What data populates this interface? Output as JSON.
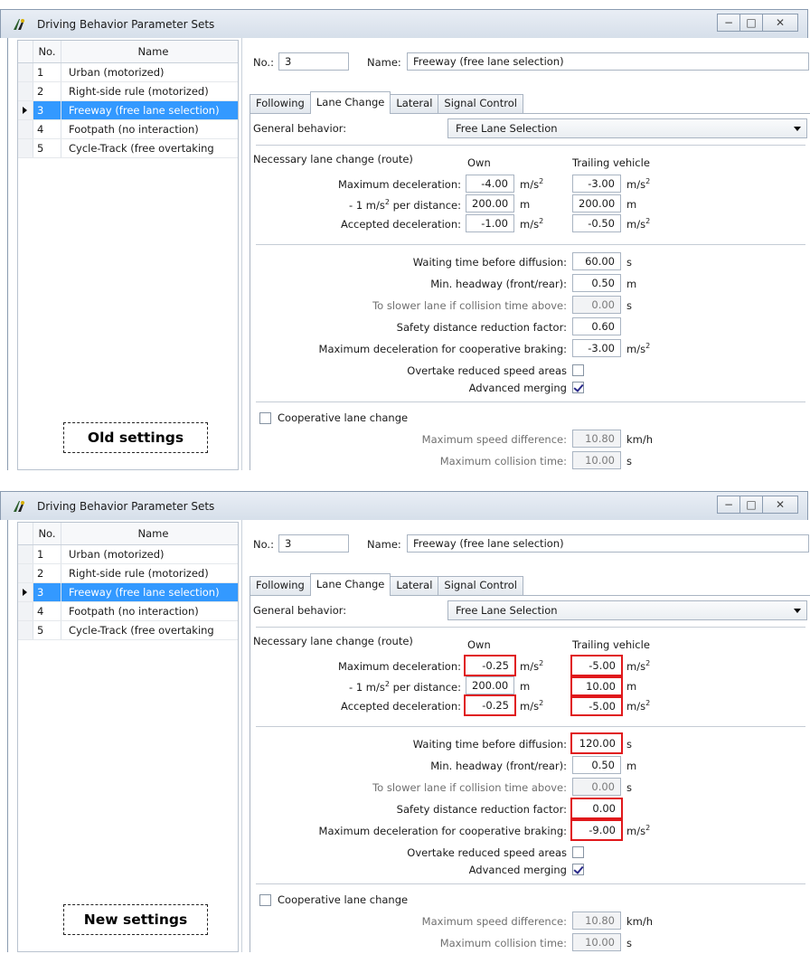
{
  "window": {
    "title": "Driving Behavior Parameter Sets",
    "buttons": {
      "minimize": "−",
      "maximize": "□",
      "close": "✕"
    }
  },
  "table": {
    "headers": {
      "no": "No.",
      "name": "Name"
    },
    "rows": [
      {
        "no": "1",
        "name": "Urban (motorized)"
      },
      {
        "no": "2",
        "name": "Right-side rule (motorized)"
      },
      {
        "no": "3",
        "name": "Freeway (free lane selection)"
      },
      {
        "no": "4",
        "name": "Footpath (no interaction)"
      },
      {
        "no": "5",
        "name": "Cycle-Track (free overtaking"
      }
    ],
    "selected_index": 2
  },
  "header": {
    "no_label": "No.:",
    "no_value": "3",
    "name_label": "Name:",
    "name_value": "Freeway (free lane selection)"
  },
  "tabs": [
    "Following",
    "Lane Change",
    "Lateral",
    "Signal Control"
  ],
  "active_tab": "Lane Change",
  "general": {
    "label": "General behavior:",
    "value": "Free Lane Selection"
  },
  "necessary": {
    "title": "Necessary lane change (route)",
    "own_header": "Own",
    "trailing_header": "Trailing vehicle",
    "max_decel_label": "Maximum deceleration:",
    "per_distance_label_pre": "- 1 m/s",
    "per_distance_label_post": " per distance:",
    "accepted_label": "Accepted deceleration:"
  },
  "params": {
    "waiting_label": "Waiting time before diffusion:",
    "headway_label": "Min. headway (front/rear):",
    "slower_label": "To slower lane if collision time above:",
    "safety_label": "Safety distance reduction factor:",
    "coop_brake_label": "Maximum deceleration for cooperative braking:",
    "overtake_label": "Overtake reduced speed areas",
    "merging_label": "Advanced merging"
  },
  "coop": {
    "label": "Cooperative lane change",
    "speed_label": "Maximum speed difference:",
    "speed_value": "10.80",
    "speed_unit": "km/h",
    "collision_label": "Maximum collision time:",
    "collision_value": "10.00",
    "collision_unit": "s"
  },
  "units": {
    "ms2_pre": "m/s",
    "sq": "2",
    "m": "m",
    "s": "s"
  },
  "old": {
    "caption": "Old settings",
    "own_max_decel": "-4.00",
    "own_per_distance": "200.00",
    "own_accepted": "-1.00",
    "trail_max_decel": "-3.00",
    "trail_per_distance": "200.00",
    "trail_accepted": "-0.50",
    "waiting": "60.00",
    "headway": "0.50",
    "slower": "0.00",
    "safety": "0.60",
    "coop_brake": "-3.00"
  },
  "new": {
    "caption": "New settings",
    "own_max_decel": "-0.25",
    "own_per_distance": "200.00",
    "own_accepted": "-0.25",
    "trail_max_decel": "-5.00",
    "trail_per_distance": "10.00",
    "trail_accepted": "-5.00",
    "waiting": "120.00",
    "headway": "0.50",
    "slower": "0.00",
    "safety": "0.00",
    "coop_brake": "-9.00"
  },
  "colors": {
    "selection": "#3399ff",
    "highlight": "#e0181b"
  }
}
